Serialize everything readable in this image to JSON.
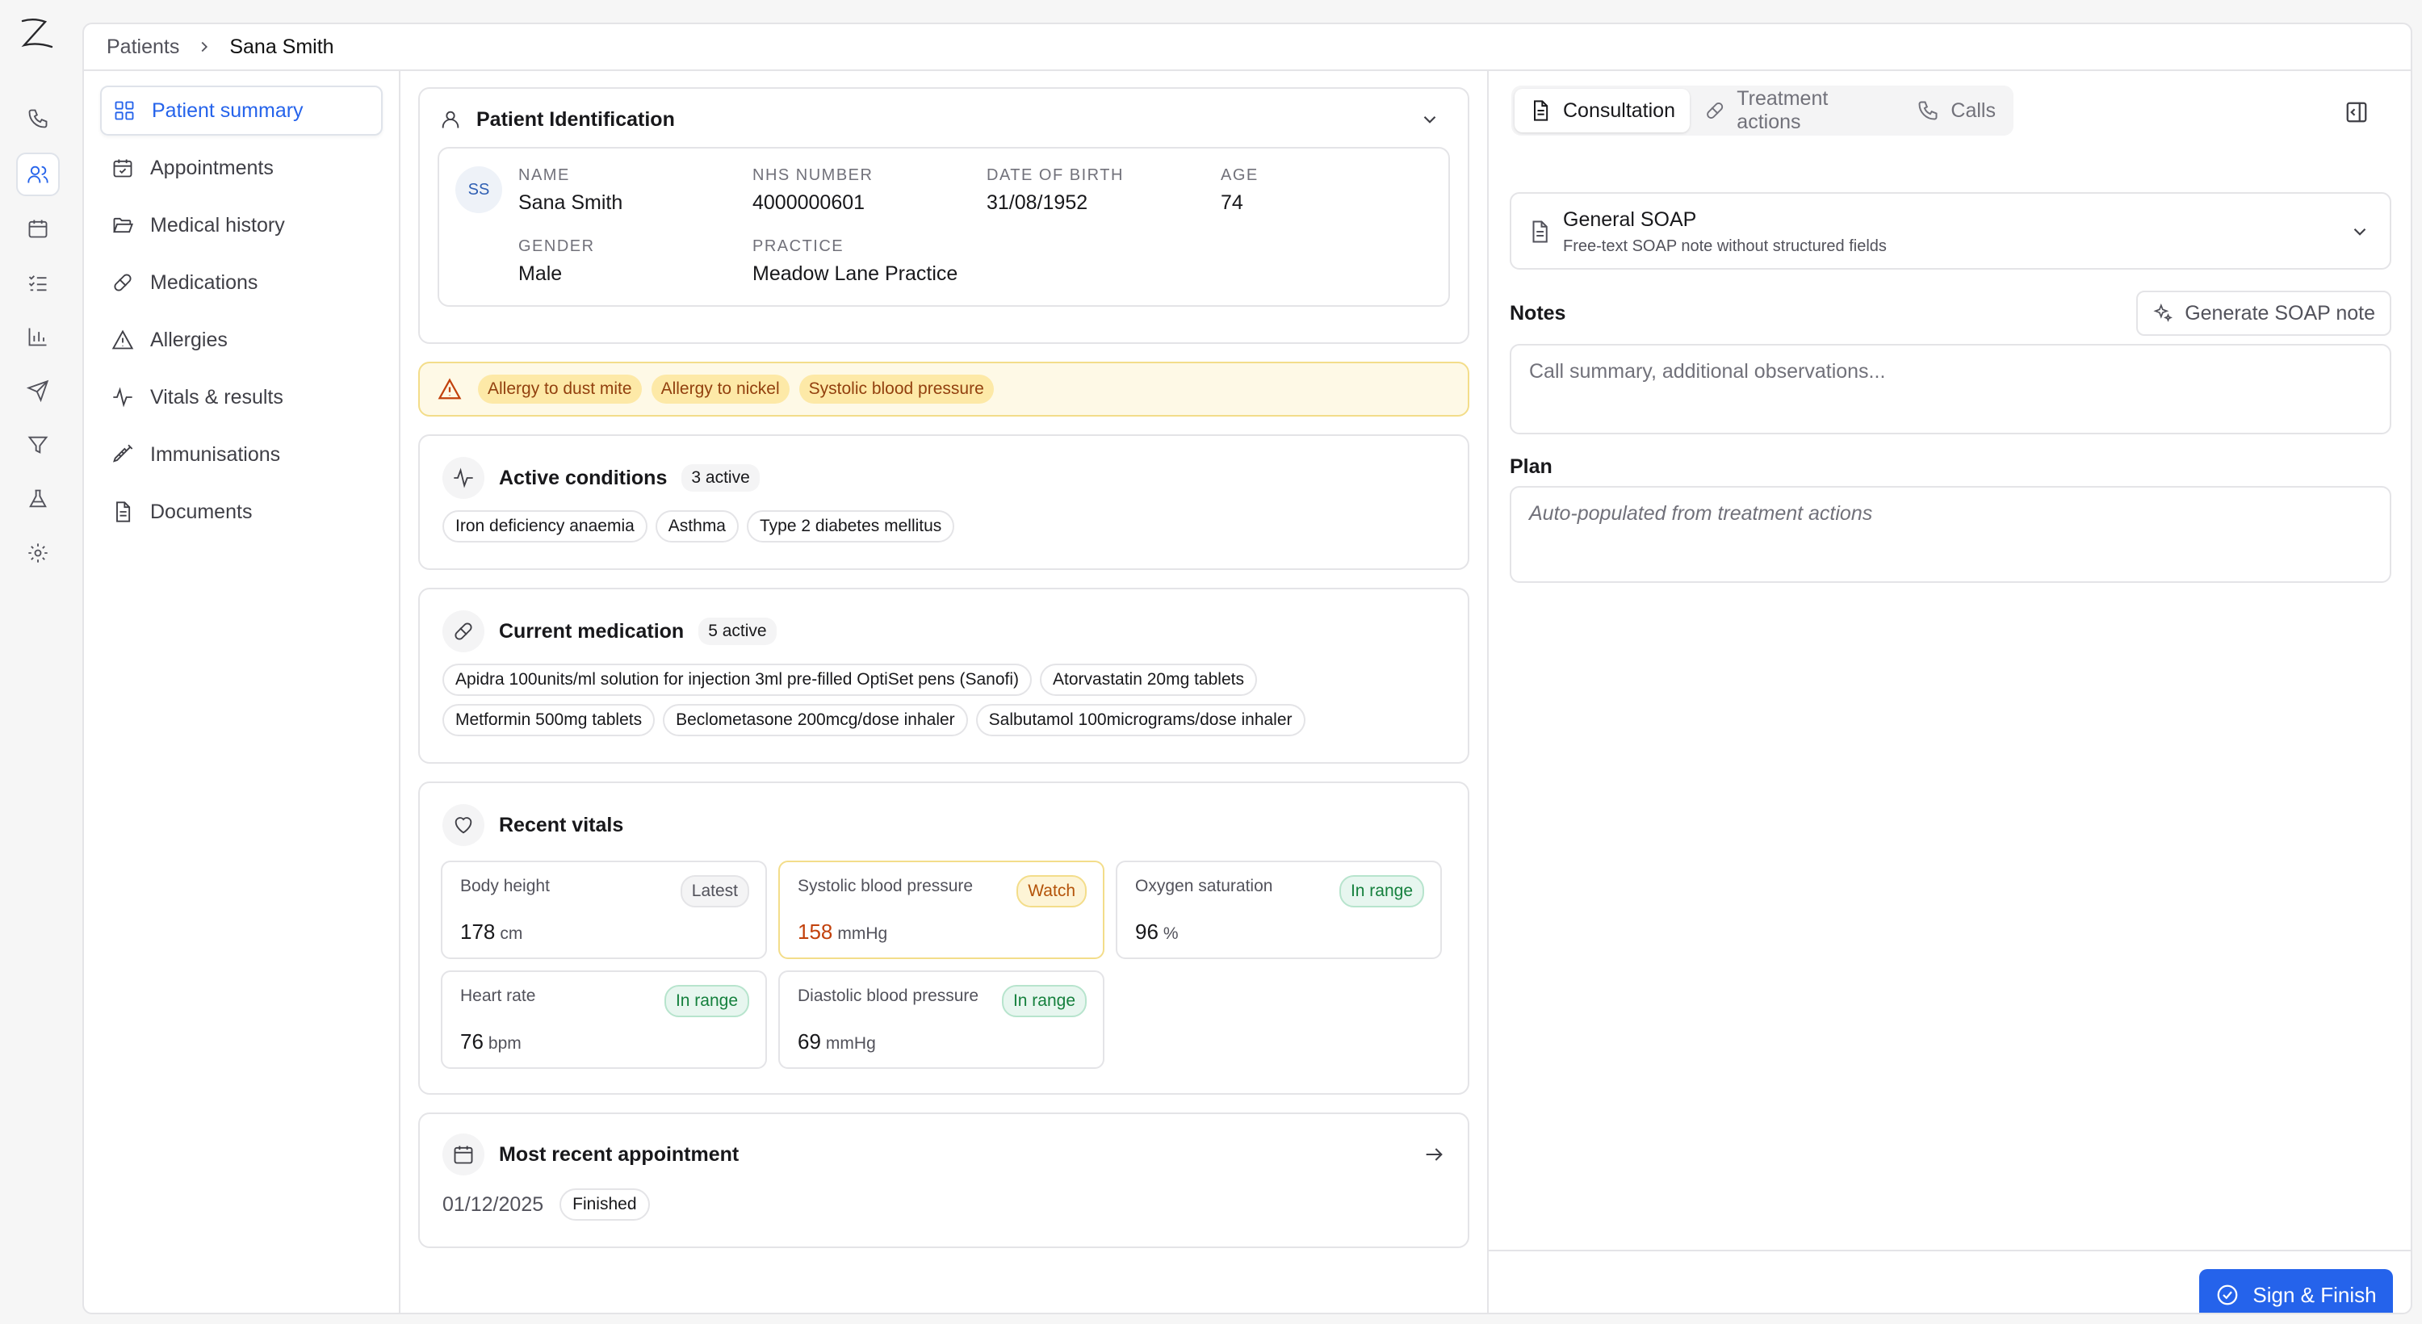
{
  "breadcrumb": {
    "parent": "Patients",
    "current": "Sana Smith"
  },
  "rail": {
    "icons": [
      "logo-z-icon",
      "phone-icon",
      "users-icon",
      "calendar-icon",
      "list-checks-icon",
      "bar-chart-icon",
      "send-icon",
      "filter-icon",
      "flask-icon",
      "settings-icon"
    ]
  },
  "sidebar": {
    "items": [
      {
        "label": "Patient summary",
        "icon": "layout-grid-icon",
        "active": true
      },
      {
        "label": "Appointments",
        "icon": "calendar-check-icon"
      },
      {
        "label": "Medical history",
        "icon": "folder-open-icon"
      },
      {
        "label": "Medications",
        "icon": "pill-icon"
      },
      {
        "label": "Allergies",
        "icon": "warning-triangle-icon"
      },
      {
        "label": "Vitals & results",
        "icon": "activity-icon"
      },
      {
        "label": "Immunisations",
        "icon": "syringe-icon"
      },
      {
        "label": "Documents",
        "icon": "file-text-icon"
      }
    ]
  },
  "identification": {
    "title": "Patient Identification",
    "initials": "SS",
    "fields": {
      "name": {
        "label": "NAME",
        "value": "Sana Smith"
      },
      "nhs": {
        "label": "NHS NUMBER",
        "value": "4000000601"
      },
      "dob": {
        "label": "DATE OF BIRTH",
        "value": "31/08/1952"
      },
      "age": {
        "label": "AGE",
        "value": "74"
      },
      "gender": {
        "label": "GENDER",
        "value": "Male"
      },
      "practice": {
        "label": "PRACTICE",
        "value": "Meadow Lane Practice"
      }
    }
  },
  "alerts": [
    "Allergy to dust mite",
    "Allergy to nickel",
    "Systolic blood pressure"
  ],
  "conditions": {
    "title": "Active conditions",
    "count": "3 active",
    "items": [
      "Iron deficiency anaemia",
      "Asthma",
      "Type 2 diabetes mellitus"
    ]
  },
  "medication": {
    "title": "Current medication",
    "count": "5 active",
    "items": [
      "Apidra 100units/ml solution for injection 3ml pre-filled OptiSet pens (Sanofi)",
      "Atorvastatin 20mg tablets",
      "Metformin 500mg tablets",
      "Beclometasone 200mcg/dose inhaler",
      "Salbutamol 100micrograms/dose inhaler"
    ]
  },
  "vitals": {
    "title": "Recent vitals",
    "items": [
      {
        "name": "Body height",
        "value": "178",
        "unit": "cm",
        "badge": "Latest"
      },
      {
        "name": "Systolic blood pressure",
        "value": "158",
        "unit": "mmHg",
        "badge": "Watch"
      },
      {
        "name": "Oxygen saturation",
        "value": "96",
        "unit": "%",
        "badge": "In range"
      },
      {
        "name": "Heart rate",
        "value": "76",
        "unit": "bpm",
        "badge": "In range"
      },
      {
        "name": "Diastolic blood pressure",
        "value": "69",
        "unit": "mmHg",
        "badge": "In range"
      }
    ]
  },
  "appointment": {
    "title": "Most recent appointment",
    "date": "01/12/2025",
    "status": "Finished"
  },
  "consult": {
    "tabs": [
      "Consultation",
      "Treatment actions",
      "Calls"
    ],
    "template_title": "General SOAP",
    "template_desc": "Free-text SOAP note without structured fields",
    "notes_label": "Notes",
    "notes_placeholder": "Call summary, additional observations...",
    "generate_label": "Generate SOAP note",
    "plan_label": "Plan",
    "plan_placeholder": "Auto-populated from treatment actions",
    "sign_label": "Sign & Finish"
  },
  "colors": {
    "accent": "#2563eb",
    "warning_bg": "#fef9e6",
    "warning_border": "#f3dd8a",
    "success": "#15803d"
  }
}
